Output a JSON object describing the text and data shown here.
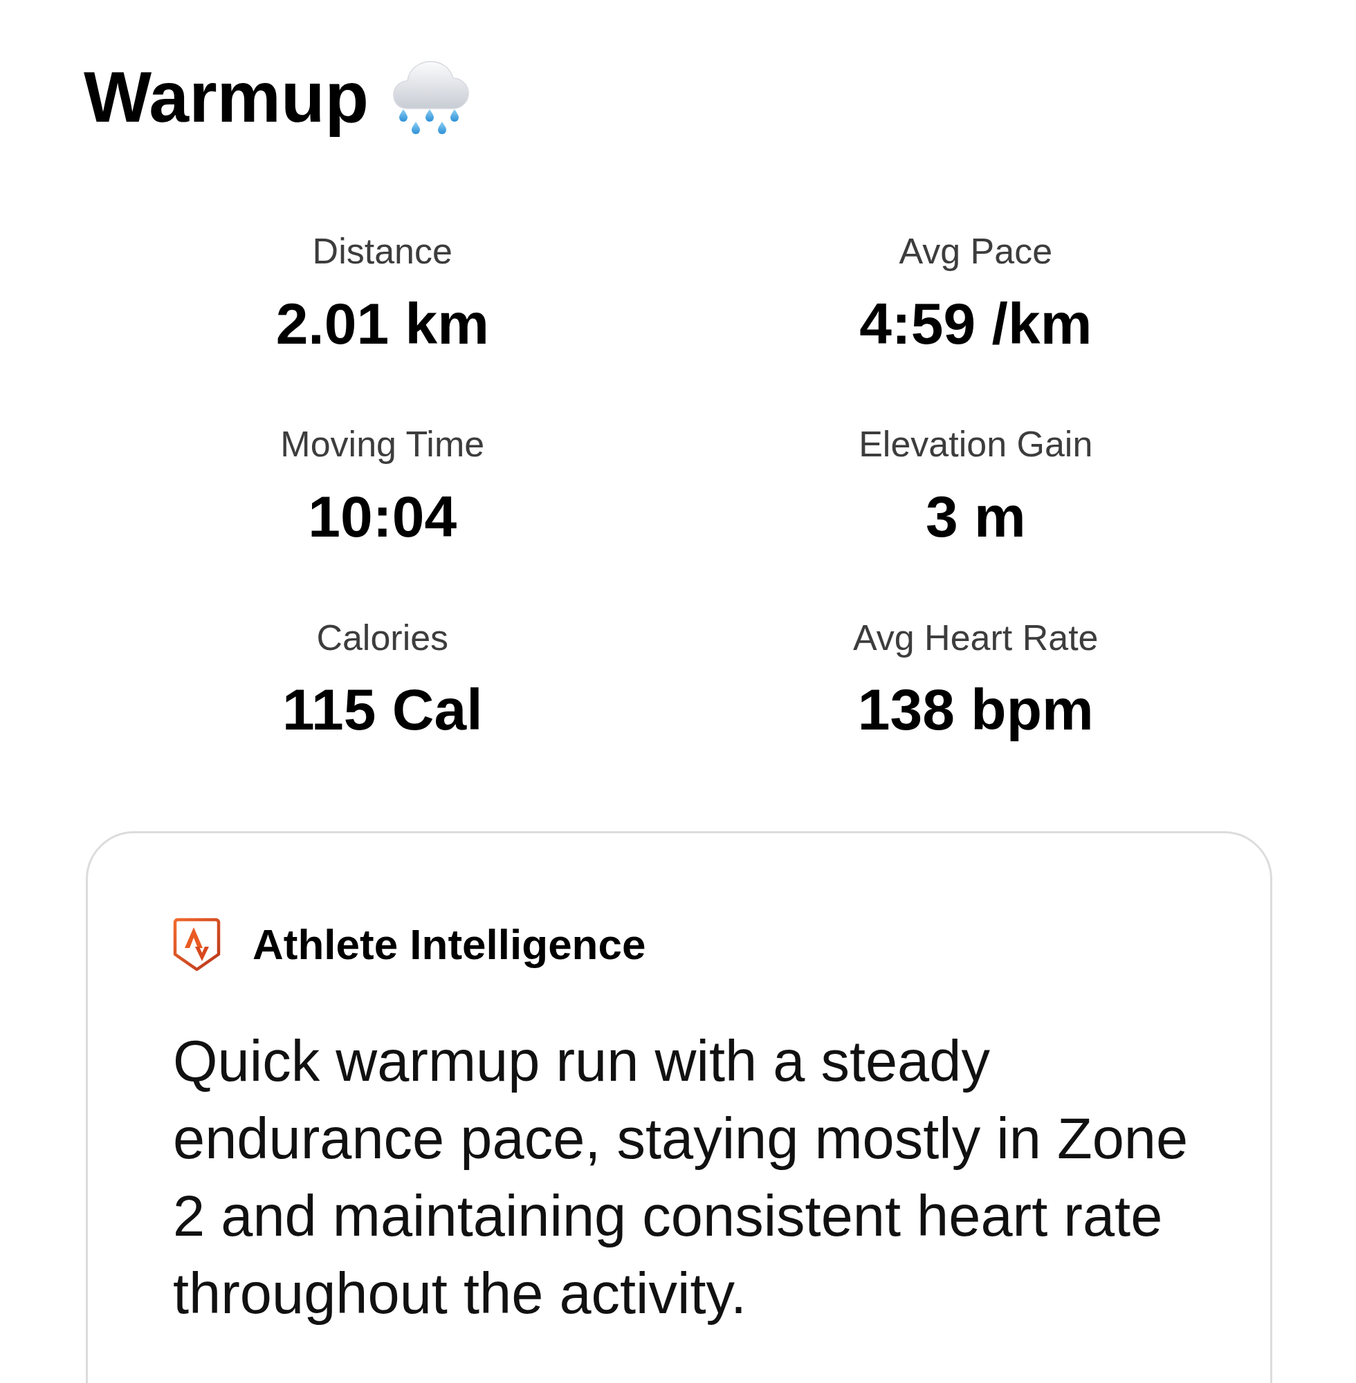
{
  "title": {
    "text": "Warmup"
  },
  "stats": [
    {
      "label": "Distance",
      "value": "2.01 km"
    },
    {
      "label": "Avg Pace",
      "value": "4:59 /km"
    },
    {
      "label": "Moving Time",
      "value": "10:04"
    },
    {
      "label": "Elevation Gain",
      "value": "3 m"
    },
    {
      "label": "Calories",
      "value": "115 Cal"
    },
    {
      "label": "Avg Heart Rate",
      "value": "138 bpm"
    }
  ],
  "insight_card": {
    "title": "Athlete Intelligence",
    "text": "Quick warmup run with a steady endurance pace, staying mostly in Zone 2 and maintaining consistent heart rate throughout the activity."
  }
}
